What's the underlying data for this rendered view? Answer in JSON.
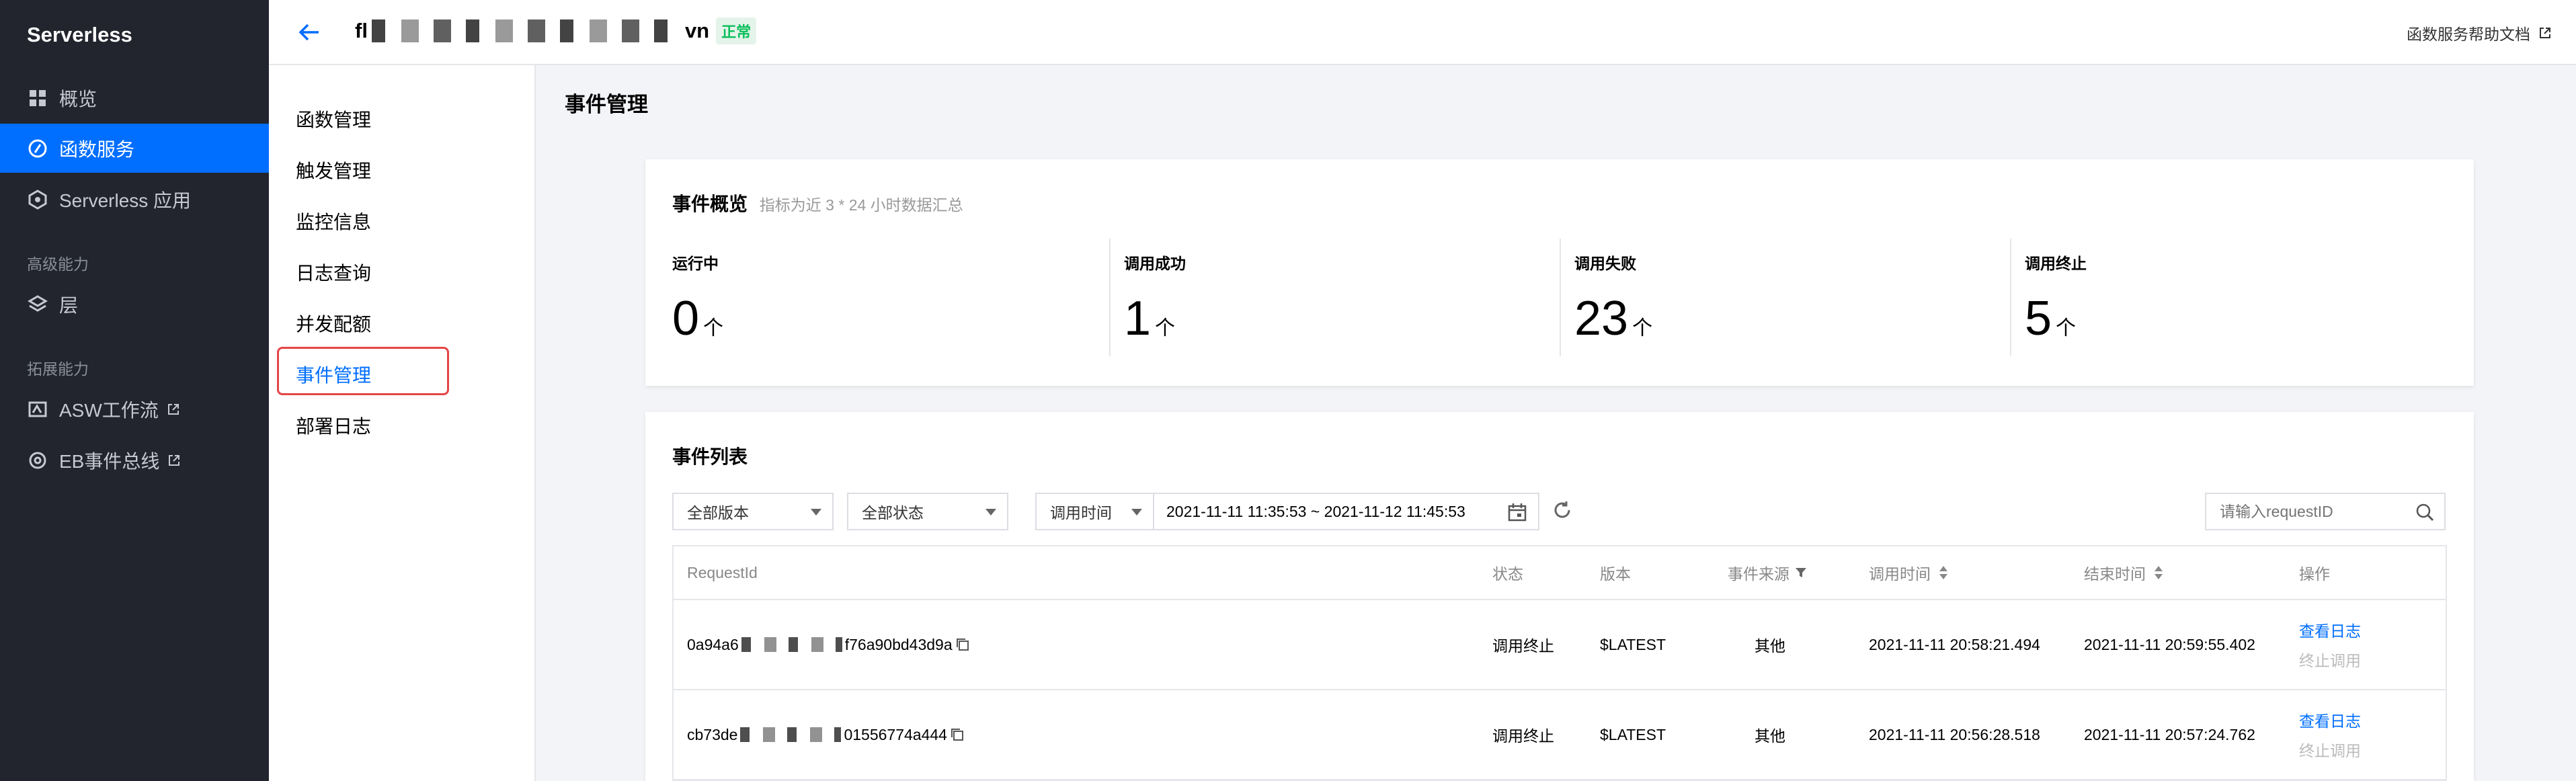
{
  "sidebar": {
    "brand": "Serverless",
    "items": [
      {
        "label": "概览",
        "icon": "grid-icon"
      },
      {
        "label": "函数服务",
        "icon": "function-icon"
      },
      {
        "label": "Serverless 应用",
        "icon": "app-icon"
      },
      {
        "label": "层",
        "icon": "layers-icon"
      },
      {
        "label": "ASW工作流",
        "icon": "workflow-icon"
      },
      {
        "label": "EB事件总线",
        "icon": "eventbus-icon"
      }
    ],
    "groups": [
      "高级能力",
      "拓展能力"
    ]
  },
  "header": {
    "function_name_prefix": "fl",
    "function_name_suffix": "vn",
    "status_badge": "正常",
    "help_link": "函数服务帮助文档"
  },
  "submenu": {
    "items": [
      "函数管理",
      "触发管理",
      "监控信息",
      "日志查询",
      "并发配额",
      "事件管理",
      "部署日志"
    ],
    "active": "事件管理"
  },
  "page": {
    "title": "事件管理"
  },
  "overview": {
    "title": "事件概览",
    "subtitle": "指标为近 3 * 24 小时数据汇总",
    "unit": "个",
    "stats": [
      {
        "label": "运行中",
        "value": "0"
      },
      {
        "label": "调用成功",
        "value": "1"
      },
      {
        "label": "调用失败",
        "value": "23"
      },
      {
        "label": "调用终止",
        "value": "5"
      }
    ]
  },
  "events": {
    "title": "事件列表",
    "filters": {
      "version": "全部版本",
      "status": "全部状态",
      "time_type": "调用时间",
      "date_range": "2021-11-11 11:35:53 ~ 2021-11-12 11:45:53",
      "search_placeholder": "请输入requestID"
    },
    "columns": [
      "RequestId",
      "状态",
      "版本",
      "事件来源",
      "调用时间",
      "结束时间",
      "操作"
    ],
    "rows": [
      {
        "request_id_prefix": "0a94a6",
        "request_id_suffix": "f76a90bd43d9a",
        "status": "调用终止",
        "version": "$LATEST",
        "source": "其他",
        "invoke_time": "2021-11-11 20:58:21.494",
        "end_time": "2021-11-11 20:59:55.402",
        "action_log": "查看日志",
        "action_stop": "终止调用"
      },
      {
        "request_id_prefix": "cb73de",
        "request_id_suffix": "01556774a444",
        "status": "调用终止",
        "version": "$LATEST",
        "source": "其他",
        "invoke_time": "2021-11-11 20:56:28.518",
        "end_time": "2021-11-11 20:57:24.762",
        "action_log": "查看日志",
        "action_stop": "终止调用"
      }
    ]
  },
  "colors": {
    "accent": "#006eff",
    "sidebar_bg": "#22252e",
    "success": "#0abf5b",
    "highlight_border": "#e54545"
  }
}
